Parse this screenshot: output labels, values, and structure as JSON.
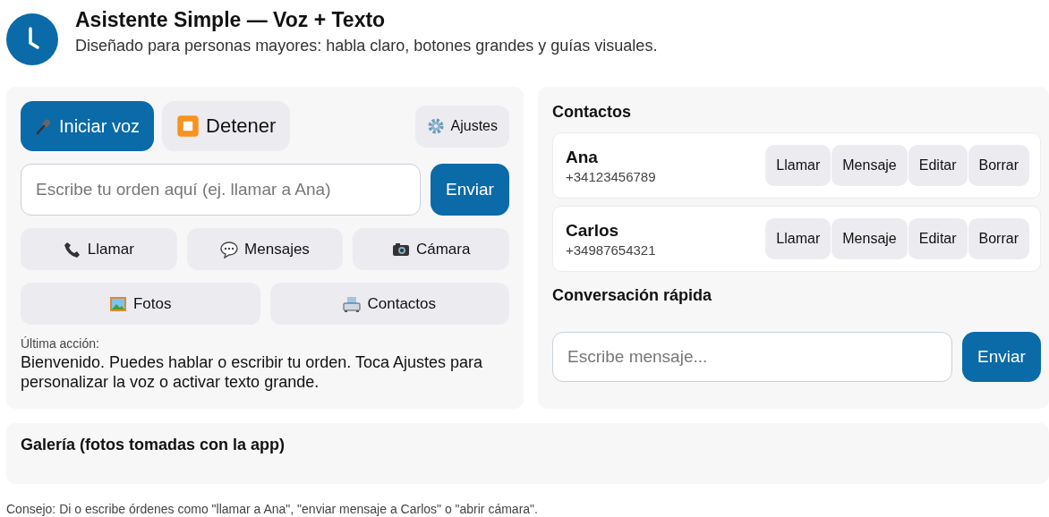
{
  "header": {
    "title": "Asistente Simple — Voz + Texto",
    "subtitle": "Diseñado para personas mayores: habla claro, botones grandes y guías visuales."
  },
  "controls": {
    "buttons": [
      {
        "label": "Iniciar voz",
        "kind": "voice"
      },
      {
        "label": "Detener",
        "kind": "stop"
      }
    ],
    "settings": {
      "label": "Ajustes"
    },
    "command": {
      "placeholder": "Escribe tu orden aquí (ej. llamar a Ana)",
      "send": "Enviar"
    },
    "shortcuts": [
      [
        {
          "label": "Llamar",
          "kind": "phone"
        },
        {
          "label": "Mensajes",
          "kind": "chat"
        },
        {
          "label": "Cámara",
          "kind": "camera"
        }
      ],
      [
        {
          "label": "Fotos",
          "kind": "picture"
        },
        {
          "label": "Contactos",
          "kind": "contacts"
        }
      ]
    ],
    "last_action": {
      "label": "Última acción:",
      "text": "Bienvenido. Puedes hablar o escribir tu orden. Toca Ajustes para personalizar la voz o activar texto grande."
    }
  },
  "contacts": {
    "title": "Contactos",
    "items": [
      {
        "name": "Ana",
        "phone": "+34123456789",
        "actions": [
          "Llamar",
          "Mensaje",
          "Editar",
          "Borrar"
        ]
      },
      {
        "name": "Carlos",
        "phone": "+34987654321",
        "actions": [
          "Llamar",
          "Mensaje",
          "Editar",
          "Borrar"
        ]
      }
    ]
  },
  "chat": {
    "title": "Conversación rápida",
    "placeholder": "Escribe mensaje...",
    "send": "Enviar"
  },
  "gallery": {
    "title": "Galería (fotos tomadas con la app)"
  },
  "footer": "Consejo: Di o escribe órdenes como \"llamar a Ana\", \"enviar mensaje a Carlos\" o \"abrir cámara\"."
}
